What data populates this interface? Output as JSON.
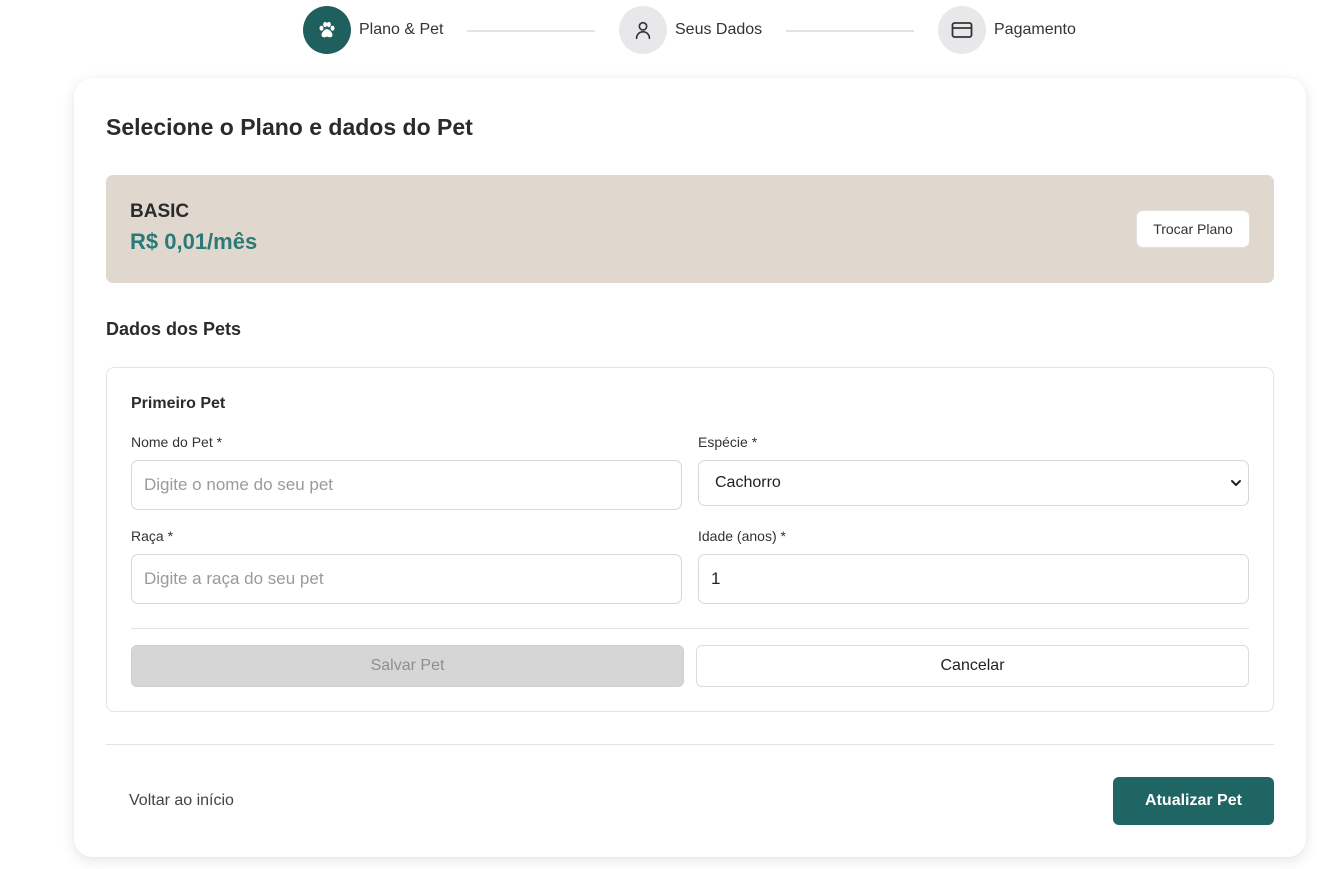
{
  "stepper": {
    "steps": [
      {
        "label": "Plano & Pet",
        "icon": "paw-icon",
        "active": true
      },
      {
        "label": "Seus Dados",
        "icon": "user-icon",
        "active": false
      },
      {
        "label": "Pagamento",
        "icon": "credit-card-icon",
        "active": false
      }
    ]
  },
  "card": {
    "title": "Selecione o Plano e dados do Pet"
  },
  "plan": {
    "name": "BASIC",
    "price": "R$ 0,01/mês",
    "change_label": "Trocar Plano"
  },
  "pets": {
    "section_title": "Dados dos Pets",
    "pet_title": "Primeiro Pet",
    "name_label": "Nome do Pet *",
    "name_value": "",
    "name_placeholder": "Digite o nome do seu pet",
    "species_label": "Espécie *",
    "species_value": "Cachorro",
    "breed_label": "Raça *",
    "breed_value": "",
    "breed_placeholder": "Digite a raça do seu pet",
    "age_label": "Idade (anos) *",
    "age_value": "1",
    "save_label": "Salvar Pet",
    "cancel_label": "Cancelar"
  },
  "footer": {
    "back_label": "Voltar ao início",
    "submit_label": "Atualizar Pet"
  },
  "colors": {
    "accent": "#1f6563",
    "price": "#2a7a77",
    "plan_bg": "#e0d8cf"
  }
}
